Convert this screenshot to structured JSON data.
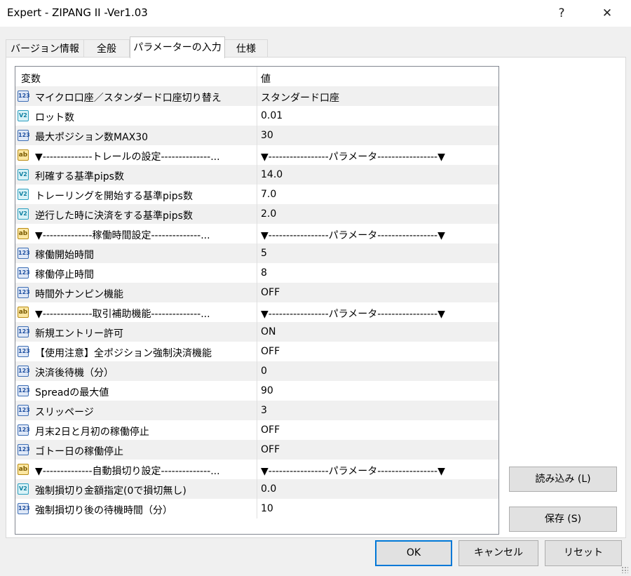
{
  "window": {
    "title": "Expert - ZIPANG II -Ver1.03",
    "help_glyph": "?",
    "close_glyph": "✕"
  },
  "tabs": [
    {
      "label": "バージョン情報"
    },
    {
      "label": "全般"
    },
    {
      "label": "パラメーターの入力"
    },
    {
      "label": "仕様"
    }
  ],
  "active_tab": "パラメーターの入力",
  "grid": {
    "headers": {
      "variable": "変数",
      "value": "値"
    },
    "rows": [
      {
        "icon": "int-type-icon",
        "badge": "123",
        "name": "マイクロ口座／スタンダード口座切り替え",
        "value": "スタンダード口座"
      },
      {
        "icon": "double-type-icon",
        "badge": "V2",
        "name": "ロット数",
        "value": "0.01"
      },
      {
        "icon": "int-type-icon",
        "badge": "123",
        "name": "最大ポジション数MAX30",
        "value": "30"
      },
      {
        "icon": "string-type-icon",
        "badge": "ab",
        "name": "▼--------------トレールの設定--------------...",
        "value": "▼-----------------パラメータ-----------------▼"
      },
      {
        "icon": "double-type-icon",
        "badge": "V2",
        "name": "利確する基準pips数",
        "value": "14.0"
      },
      {
        "icon": "double-type-icon",
        "badge": "V2",
        "name": "トレーリングを開始する基準pips数",
        "value": "7.0"
      },
      {
        "icon": "double-type-icon",
        "badge": "V2",
        "name": "逆行した時に決済をする基準pips数",
        "value": "2.0"
      },
      {
        "icon": "string-type-icon",
        "badge": "ab",
        "name": "▼--------------稼働時間設定--------------...",
        "value": "▼-----------------パラメータ-----------------▼"
      },
      {
        "icon": "int-type-icon",
        "badge": "123",
        "name": "稼働開始時間",
        "value": "5"
      },
      {
        "icon": "int-type-icon",
        "badge": "123",
        "name": "稼働停止時間",
        "value": "8"
      },
      {
        "icon": "int-type-icon",
        "badge": "123",
        "name": "時間外ナンピン機能",
        "value": "OFF"
      },
      {
        "icon": "string-type-icon",
        "badge": "ab",
        "name": "▼--------------取引補助機能--------------...",
        "value": "▼-----------------パラメータ-----------------▼"
      },
      {
        "icon": "int-type-icon",
        "badge": "123",
        "name": "新規エントリー許可",
        "value": "ON"
      },
      {
        "icon": "int-type-icon",
        "badge": "123",
        "name": "【使用注意】全ポジション強制決済機能",
        "value": "OFF"
      },
      {
        "icon": "int-type-icon",
        "badge": "123",
        "name": "決済後待機（分）",
        "value": "0"
      },
      {
        "icon": "int-type-icon",
        "badge": "123",
        "name": "Spreadの最大値",
        "value": "90"
      },
      {
        "icon": "int-type-icon",
        "badge": "123",
        "name": "スリッページ",
        "value": "3"
      },
      {
        "icon": "int-type-icon",
        "badge": "123",
        "name": "月末2日と月初の稼働停止",
        "value": "OFF"
      },
      {
        "icon": "int-type-icon",
        "badge": "123",
        "name": "ゴトー日の稼働停止",
        "value": "OFF"
      },
      {
        "icon": "string-type-icon",
        "badge": "ab",
        "name": "▼--------------自動損切り設定--------------...",
        "value": "▼-----------------パラメータ-----------------▼"
      },
      {
        "icon": "double-type-icon",
        "badge": "V2",
        "name": "強制損切り金額指定(0で損切無し)",
        "value": "0.0"
      },
      {
        "icon": "int-type-icon",
        "badge": "123",
        "name": "強制損切り後の待機時間（分）",
        "value": "10"
      }
    ]
  },
  "buttons": {
    "load": "読み込み (L)",
    "save": "保存 (S)",
    "ok": "OK",
    "cancel": "キャンセル",
    "reset": "リセット"
  }
}
